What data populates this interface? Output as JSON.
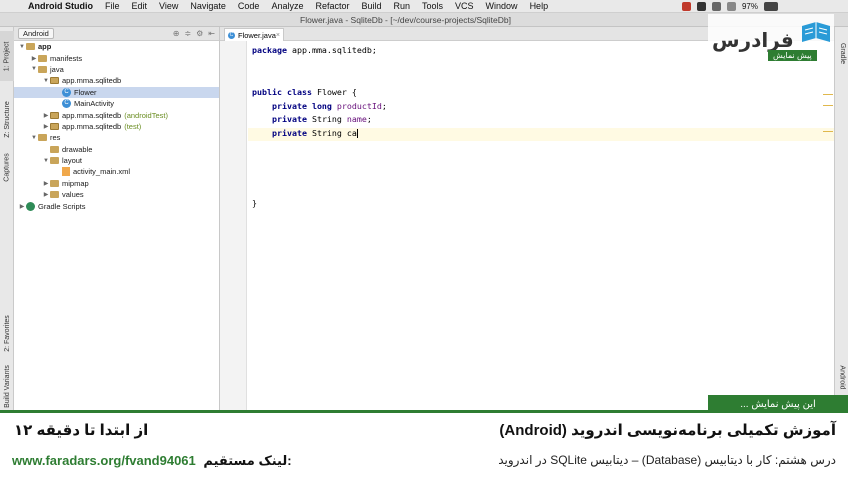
{
  "menubar": {
    "app_name": "Android Studio",
    "items": [
      "File",
      "Edit",
      "View",
      "Navigate",
      "Code",
      "Analyze",
      "Refactor",
      "Build",
      "Run",
      "Tools",
      "VCS",
      "Window",
      "Help"
    ],
    "battery": "97%"
  },
  "window": {
    "title": "Flower.java - SqliteDb - [~/dev/course-projects/SqliteDb]"
  },
  "left_tool_tabs": [
    "1: Project",
    "Z: Structure",
    "Captures",
    "2: Favorites",
    "Build Variants"
  ],
  "right_tool_tabs": [
    "Gradle",
    "Android"
  ],
  "project_panel": {
    "view_selector": "Android",
    "tree": [
      {
        "label": "app",
        "indent": 0,
        "icon": "folder",
        "arrow": "down",
        "bold": true
      },
      {
        "label": "manifests",
        "indent": 1,
        "icon": "folder",
        "arrow": "right"
      },
      {
        "label": "java",
        "indent": 1,
        "icon": "folder",
        "arrow": "down"
      },
      {
        "label": "app.mma.sqlitedb",
        "indent": 2,
        "icon": "package",
        "arrow": "down"
      },
      {
        "label": "Flower",
        "indent": 3,
        "icon": "class",
        "arrow": "",
        "selected": true
      },
      {
        "label": "MainActivity",
        "indent": 3,
        "icon": "class",
        "arrow": ""
      },
      {
        "label": "app.mma.sqlitedb",
        "indent": 2,
        "icon": "package",
        "arrow": "right",
        "note": "(androidTest)"
      },
      {
        "label": "app.mma.sqlitedb",
        "indent": 2,
        "icon": "package",
        "arrow": "right",
        "note": "(test)"
      },
      {
        "label": "res",
        "indent": 1,
        "icon": "folder",
        "arrow": "down"
      },
      {
        "label": "drawable",
        "indent": 2,
        "icon": "folder",
        "arrow": ""
      },
      {
        "label": "layout",
        "indent": 2,
        "icon": "folder",
        "arrow": "down"
      },
      {
        "label": "activity_main.xml",
        "indent": 3,
        "icon": "xml",
        "arrow": ""
      },
      {
        "label": "mipmap",
        "indent": 2,
        "icon": "folder",
        "arrow": "right"
      },
      {
        "label": "values",
        "indent": 2,
        "icon": "folder",
        "arrow": "right"
      },
      {
        "label": "Gradle Scripts",
        "indent": 0,
        "icon": "gradle",
        "arrow": "right"
      }
    ]
  },
  "editor": {
    "tab_label": "Flower.java",
    "code_lines": [
      [
        {
          "t": "package",
          "c": "kw"
        },
        {
          "t": " app.mma.sqlitedb;",
          "c": ""
        }
      ],
      [],
      [],
      [
        {
          "t": "public class",
          "c": "kw"
        },
        {
          "t": " Flower {",
          "c": ""
        }
      ],
      [
        {
          "t": "    ",
          "c": ""
        },
        {
          "t": "private long",
          "c": "kw"
        },
        {
          "t": " productId",
          "c": "fld"
        },
        {
          "t": ";",
          "c": ""
        }
      ],
      [
        {
          "t": "    ",
          "c": ""
        },
        {
          "t": "private",
          "c": "kw"
        },
        {
          "t": " String ",
          "c": ""
        },
        {
          "t": "name",
          "c": "fld"
        },
        {
          "t": ";",
          "c": ""
        }
      ],
      [
        {
          "t": "    ",
          "c": ""
        },
        {
          "t": "private",
          "c": "kw"
        },
        {
          "t": " String ca",
          "c": ""
        },
        {
          "t": "",
          "c": "caret"
        }
      ],
      [],
      [],
      [],
      [],
      [
        {
          "t": "}",
          "c": ""
        }
      ]
    ]
  },
  "logo": {
    "name": "فرادرس",
    "badge": "پیش نمایش"
  },
  "banner": {
    "flag": "این پیش نمایش ...",
    "title": "آموزش تکمیلی برنامه‌نویسی اندروید (Android)",
    "subtitle": "درس هشتم: کار با دیتابیس (Database) – دیتابیس SQLite در اندروید",
    "range": "از ابتدا تا دقیقه ۱۲",
    "link_label": "لینک مستقیم:",
    "link_url": "www.faradars.org/fvand94061"
  },
  "colors": {
    "brand_green": "#2e7d32",
    "keyword": "#000080",
    "field": "#660e7a"
  }
}
